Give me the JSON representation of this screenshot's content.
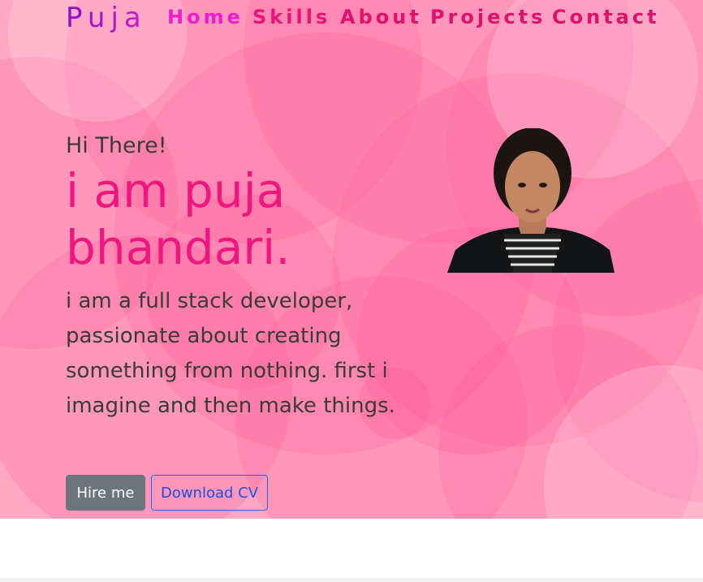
{
  "nav": {
    "brand": "Puja",
    "links": [
      {
        "label": "Home",
        "color": "#f01ad0"
      },
      {
        "label": "Skills",
        "color": "#e8147a"
      },
      {
        "label": "About",
        "color": "#e0106e"
      },
      {
        "label": "Projects",
        "color": "#e0106e"
      },
      {
        "label": "Contact",
        "color": "#e0106e"
      }
    ]
  },
  "hero": {
    "greeting": "Hi There!",
    "name": "i am puja bhandari.",
    "description": "i am a full stack developer, passionate about creating something from nothing. first i imagine and then make things.",
    "buttons": {
      "hire": "Hire me",
      "cv": "Download CV"
    },
    "photo_icon": "profile-photo"
  },
  "colors": {
    "accent": "#f0157f",
    "hero_bg": "#ffa8c4",
    "hire_bg": "#6c757d",
    "cv_border": "#2f5ff0"
  }
}
